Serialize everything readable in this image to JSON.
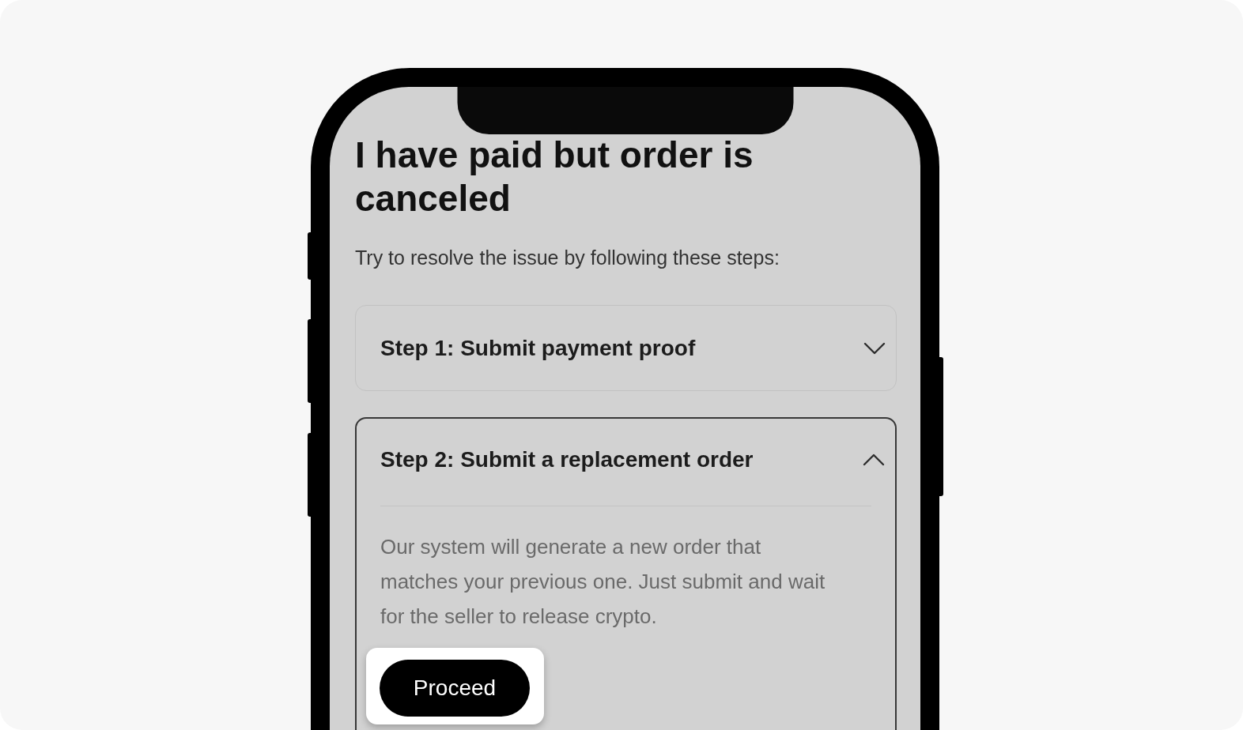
{
  "screen": {
    "title": "I have paid but order is canceled",
    "subtitle": "Try to resolve the issue by following these steps:",
    "steps": [
      {
        "title": "Step 1: Submit payment proof",
        "expanded": false
      },
      {
        "title": "Step 2: Submit a replacement order",
        "expanded": true,
        "description": "Our system will generate a new order that matches your previous one. Just submit and wait for the seller to release crypto.",
        "button": {
          "label": "Proceed",
          "highlighted": true
        }
      }
    ]
  }
}
